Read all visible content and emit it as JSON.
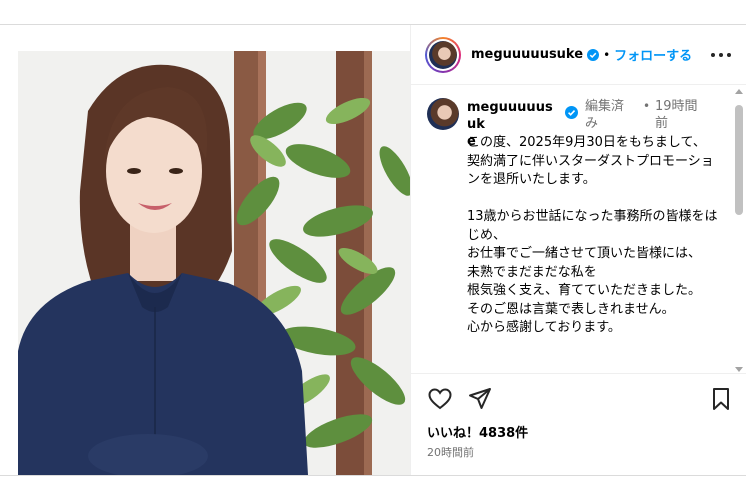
{
  "post": {
    "username": "meguuuuusuke",
    "username_wrapped_line1": "meguuuuusuk",
    "username_wrapped_line2": "e",
    "follow_label": "フォローする",
    "separator": "•",
    "caption": {
      "edited_line1": "編集済",
      "edited_line2": "み",
      "time_line1": "19時間",
      "time_line2": "前",
      "text": "この度、2025年9月30日をもちまして、\n契約満了に伴いスターダストプロモーションを退所いたします。\n\n13歳からお世話になった事務所の皆様をはじめ、\nお仕事でご一緒させて頂いた皆様には、\n未熟でまだまだな私を\n根気強く支え、育てていただきました。\nそのご恩は言葉で表しきれません。\n心から感謝しております。"
    },
    "likes_label": "いいね！4838件",
    "time_ago": "20時間前"
  },
  "icons": {
    "verified": "verified-badge-icon",
    "more": "more-options-icon",
    "like": "heart-icon",
    "share": "paper-plane-icon",
    "save": "bookmark-icon"
  },
  "colors": {
    "link": "#0095f6",
    "verified": "#0095f6",
    "muted": "#737373"
  }
}
